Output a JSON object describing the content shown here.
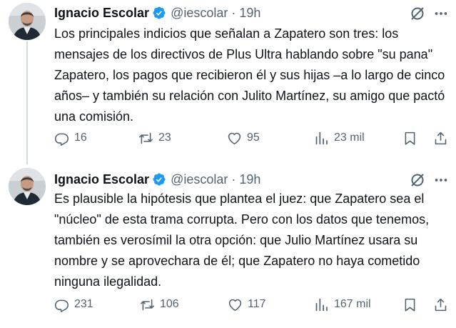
{
  "colors": {
    "text_primary": "#0f1419",
    "text_secondary": "#536471",
    "verified_badge": "#1d9bf0",
    "thread_line": "#cfd9de",
    "background": "#ffffff"
  },
  "tweets": [
    {
      "author_name": "Ignacio Escolar",
      "verified": true,
      "handle": "@iescolar",
      "separator": "·",
      "time": "19h",
      "text": "Los principales indicios que señalan a Zapatero son tres: los mensajes de los directivos de Plus Ultra hablando sobre \"su pana\" Zapatero, los pagos que recibieron él y sus hijas –a lo largo de cinco años– y también su relación con Julito Martínez, su amigo que pactó una comisión.",
      "replies": "16",
      "reposts": "23",
      "likes": "95",
      "views": "23 mil",
      "icons": [
        "grok-icon",
        "more-icon",
        "reply-icon",
        "repost-icon",
        "like-icon",
        "views-icon",
        "bookmark-icon",
        "share-icon"
      ]
    },
    {
      "author_name": "Ignacio Escolar",
      "verified": true,
      "handle": "@iescolar",
      "separator": "·",
      "time": "19h",
      "text": "Es plausible la hipótesis que plantea el juez: que Zapatero sea el \"núcleo\" de esta trama corrupta. Pero con los datos que tenemos, también es verosímil la otra opción: que Julio Martínez usara su nombre y se aprovechara de él; que Zapatero no haya cometido ninguna ilegalidad.",
      "replies": "231",
      "reposts": "106",
      "likes": "117",
      "views": "167 mil",
      "icons": [
        "grok-icon",
        "more-icon",
        "reply-icon",
        "repost-icon",
        "like-icon",
        "views-icon",
        "bookmark-icon",
        "share-icon"
      ]
    }
  ]
}
